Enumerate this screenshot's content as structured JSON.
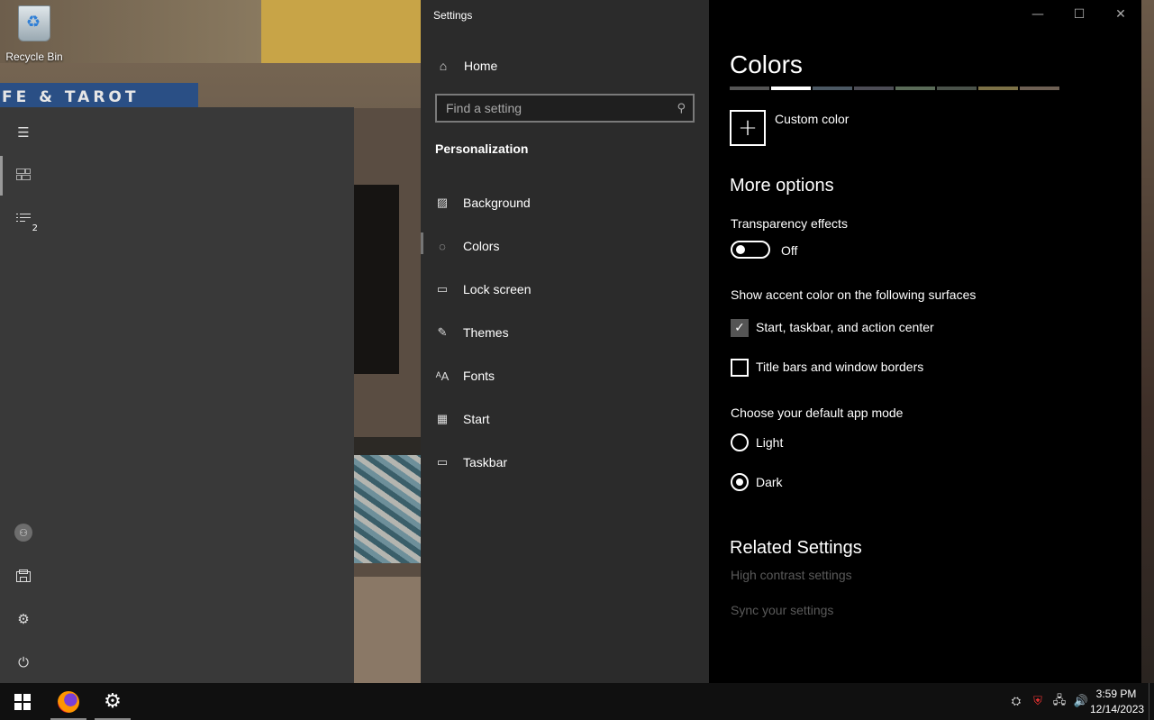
{
  "desktop": {
    "recycle_bin_label": "Recycle Bin",
    "wallpaper_sign_text": "FE & TAROT"
  },
  "start_menu": {
    "rail_icons": [
      "hamburger-icon",
      "tiles-icon",
      "list-icon",
      "user-icon",
      "documents-icon",
      "gear-icon",
      "power-icon"
    ],
    "list_badge": "2"
  },
  "settings": {
    "window_title": "Settings",
    "controls": {
      "minimize": "—",
      "maximize": "☐",
      "close": "✕"
    },
    "nav": {
      "home_label": "Home",
      "search_placeholder": "Find a setting",
      "section_title": "Personalization",
      "items": [
        {
          "label": "Background",
          "icon": "picture-icon"
        },
        {
          "label": "Colors",
          "icon": "palette-icon"
        },
        {
          "label": "Lock screen",
          "icon": "lock-screen-icon"
        },
        {
          "label": "Themes",
          "icon": "themes-icon"
        },
        {
          "label": "Fonts",
          "icon": "fonts-icon"
        },
        {
          "label": "Start",
          "icon": "start-icon"
        },
        {
          "label": "Taskbar",
          "icon": "taskbar-icon"
        }
      ],
      "selected": "Colors"
    },
    "content": {
      "title": "Colors",
      "swatch_colors": [
        "#555555",
        "#ffffff",
        "#4b5863",
        "#4c4c55",
        "#5a6b58",
        "#4a524a",
        "#7c7146",
        "#6e6054"
      ],
      "selected_swatch_index": 1,
      "custom_color_label": "Custom color",
      "more_options_title": "More options",
      "transparency_label": "Transparency effects",
      "transparency_state": "Off",
      "accent_surfaces_label": "Show accent color on the following surfaces",
      "checkboxes": [
        {
          "label": "Start, taskbar, and action center",
          "checked": true
        },
        {
          "label": "Title bars and window borders",
          "checked": false
        }
      ],
      "app_mode_label": "Choose your default app mode",
      "radios": [
        {
          "label": "Light",
          "selected": false
        },
        {
          "label": "Dark",
          "selected": true
        }
      ],
      "related_title": "Related Settings",
      "related_links": [
        "High contrast settings",
        "Sync your settings"
      ]
    }
  },
  "taskbar": {
    "apps": [
      "firefox-icon",
      "settings-gear-icon"
    ],
    "tray_icons": [
      "network-badge-icon",
      "security-icon",
      "network-icon",
      "volume-icon"
    ],
    "time": "3:59 PM",
    "date": "12/14/2023"
  }
}
